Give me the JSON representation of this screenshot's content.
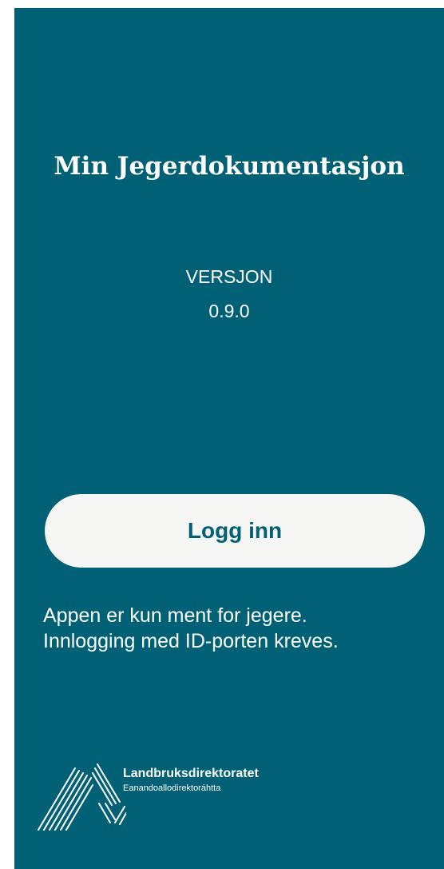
{
  "app": {
    "title": "Min Jegerdokumentasjon",
    "version_label": "VERSJON",
    "version_number": "0.9.0"
  },
  "login": {
    "button_label": "Logg inn"
  },
  "info": {
    "line1": "Appen er kun ment for jegere.",
    "line2": "Innlogging med ID-porten kreves."
  },
  "logo": {
    "icon": "landbruksdirektoratet-logo",
    "name": "Landbruksdirektoratet",
    "subtitle": "Eanandoallodirektoráhtta"
  },
  "colors": {
    "background": "#006075",
    "button_background": "#f6f6f4",
    "button_text": "#006075",
    "text": "#ffffff"
  }
}
